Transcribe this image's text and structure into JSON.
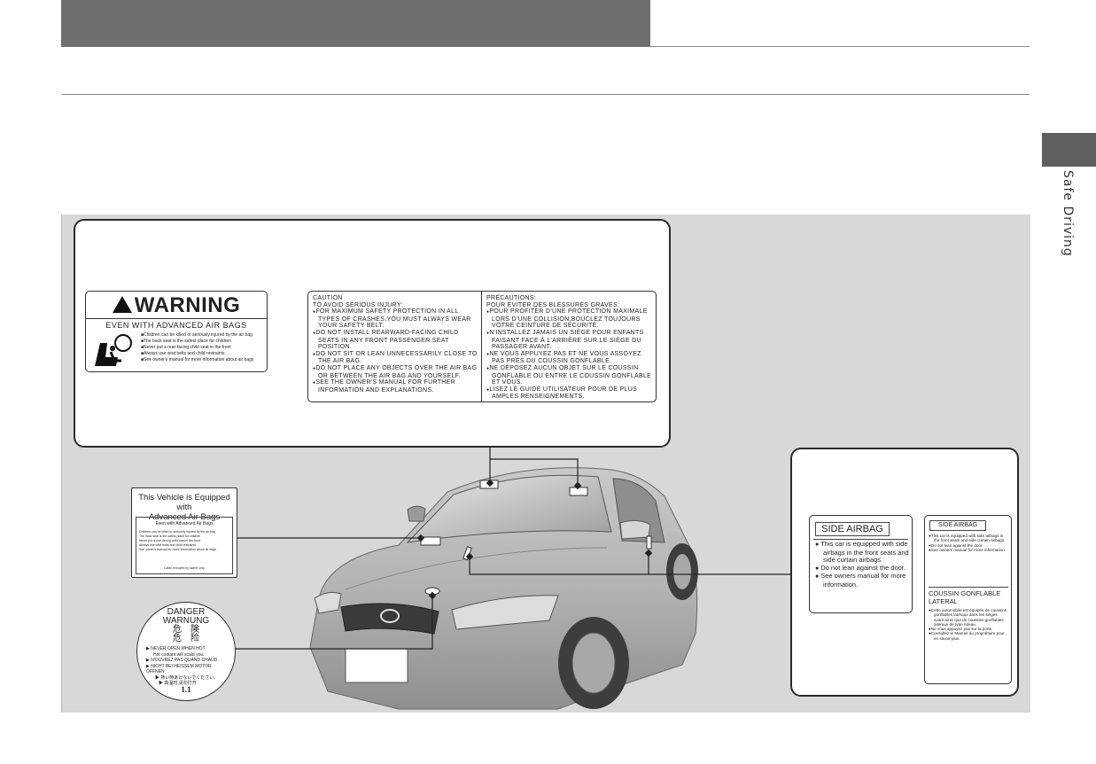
{
  "sidebar": {
    "section_label": "Safe Driving"
  },
  "warning_label": {
    "title": "WARNING",
    "subtitle": "EVEN WITH ADVANCED AIR BAGS",
    "items": [
      "Children can be killed or seriously injured by the air bag",
      "The back seat is the safest place for children",
      "Never put a rear-facing child seat in the front",
      "Always use seat belts and child restraints",
      "See owner's manual for more information about air bags"
    ]
  },
  "caution_label": {
    "en_heading": "CAUTION",
    "en_subheading": "TO AVOID SERIOUS INJURY:",
    "en_items": [
      "FOR MAXIMUM SAFETY PROTECTION IN ALL TYPES OF CRASHES,YOU MUST ALWAYS WEAR YOUR SAFETY BELT.",
      "DO NOT INSTALL REARWARD-FACING CHILD SEATS IN ANY FRONT PASSENGER SEAT POSITION.",
      "DO NOT SIT OR LEAN UNNECESSARILY CLOSE TO THE AIR BAG.",
      "DO NOT PLACE ANY OBJECTS OVER THE AIR BAG OR BETWEEN THE AIR BAG AND YOURSELF.",
      "SEE THE OWNER'S MANUAL FOR FURTHER INFORMATION AND EXPLANATIONS."
    ],
    "fr_heading": "PRÉCAUTIONS:",
    "fr_subheading": "POUR ÉVITER DES BLESSURES GRAVES:",
    "fr_items": [
      "POUR PROFITER D'UNE PROTECTION MAXIMALE LORS D'UNE COLLISION,BOUCLEZ TOUJOURS VOTRE CEINTURE DE SÉCURITÉ.",
      "N'INSTALLEZ JAMAIS UN SIÈGE POUR ENFANTS FAISANT FACE À L'ARRIÈRE SUR LE SIÈGE DU PASSAGER AVANT.",
      "NE VOUS APPUYEZ PAS ET NE VOUS ASSOYEZ PAS PRÈS DU COUSSIN GONFLABLE.",
      "NE DÉPOSEZ AUCUN OBJET SUR LE COUSSIN GONFLABLE OU ENTRE LE COUSSIN GONFLABLE ET VOUS.",
      "LISEZ LE GUIDE UTILISATEUR POUR DE PLUS AMPLES RENSEIGNEMENTS."
    ]
  },
  "equipped_label": {
    "title_line1": "This Vehicle is Equipped with",
    "title_line2": "Advanced Air Bags",
    "subtitle": "Even with Advanced Air Bags",
    "items": [
      "Children can be killed or seriously injured by the air bag",
      "The back seat is the safest place for children",
      "Never put a rear-facing child seat in the front",
      "Always use seat belts and child restraints",
      "See owner's manual for more information about air bags"
    ],
    "footer": "Label removed by owner only"
  },
  "danger_label": {
    "line1": "DANGER",
    "line2": "WARNUNG",
    "line3": "危　険",
    "line4": "危　险",
    "lines": [
      "▶ NEVER OPEN WHEN HOT",
      "Hot coolant will scald you.",
      "▶ N'OUVREZ PAS QUAND CHAUD",
      "▶ NICHT BEI HEISSEM MOTOR ÖFFNEN",
      "▶ 熱い時あけないでください。",
      "▶ 高温时,请勿打开"
    ],
    "number": "1.1"
  },
  "side_airbag_en": {
    "title": "SIDE AIRBAG",
    "items": [
      "This car is equipped with side airbags in the front seats and side curtain airbags.",
      "Do not lean against the door.",
      "See owners manual for more information."
    ]
  },
  "side_airbag_fr": {
    "title": "SIDE AIRBAG",
    "items1": [
      "This car is equipped with side airbags in the front seats and side curtain airbags.",
      "Do not lean against the door.",
      "See owners manual for more information."
    ],
    "heading2_line1": "COUSSIN GONFLABLE",
    "heading2_line2": "LATERAL",
    "items2": [
      "Cette automobile est équipée de coussins gonflables latéraux dans les sièges avant ainsi que de coussins gonflables latéraux de type rideau.",
      "Ne vous appuyez pas sur la porte.",
      "Consultez le Manuel du propriétaire pour en savoir plus."
    ]
  }
}
